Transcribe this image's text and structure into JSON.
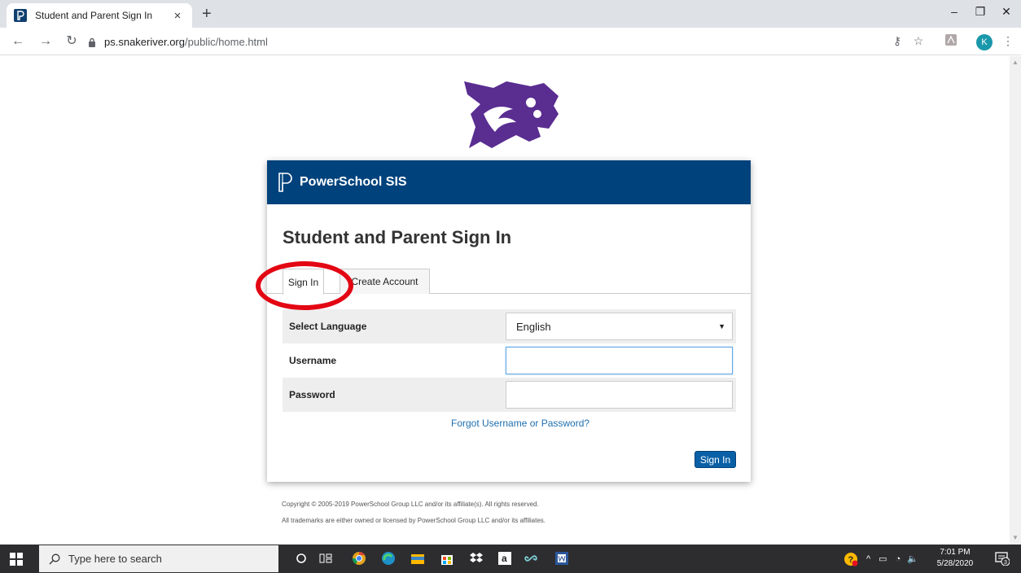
{
  "browser": {
    "tab_title": "Student and Parent Sign In",
    "tab_close": "×",
    "new_tab": "+",
    "url_host": "ps.snakeriver.org",
    "url_path": "/public/home.html"
  },
  "card": {
    "brand": "PowerSchool SIS",
    "title": "Student and Parent Sign In",
    "tabs": [
      "Sign In",
      "Create Account"
    ],
    "rows": [
      {
        "label": "Select Language",
        "value": "English"
      },
      {
        "label": "Username",
        "value": ""
      },
      {
        "label": "Password",
        "value": ""
      }
    ],
    "forgot": "Forgot Username or Password?",
    "sign_in_button": "Sign In"
  },
  "footer": {
    "line1": "Copyright © 2005-2019 PowerSchool Group LLC and/or its affiliate(s). All rights reserved.",
    "line2": "All trademarks are either owned or licensed by PowerSchool Group LLC and/or its affiliates."
  },
  "taskbar": {
    "search_placeholder": "Type here to search",
    "time": "7:01 PM",
    "date": "5/28/2020",
    "notifications": "3"
  },
  "colors": {
    "header": "#00427c",
    "link": "#1e6fb0",
    "button": "#0a60a6",
    "annotation": "#e30613",
    "logo_purple": "#5a2d91"
  }
}
